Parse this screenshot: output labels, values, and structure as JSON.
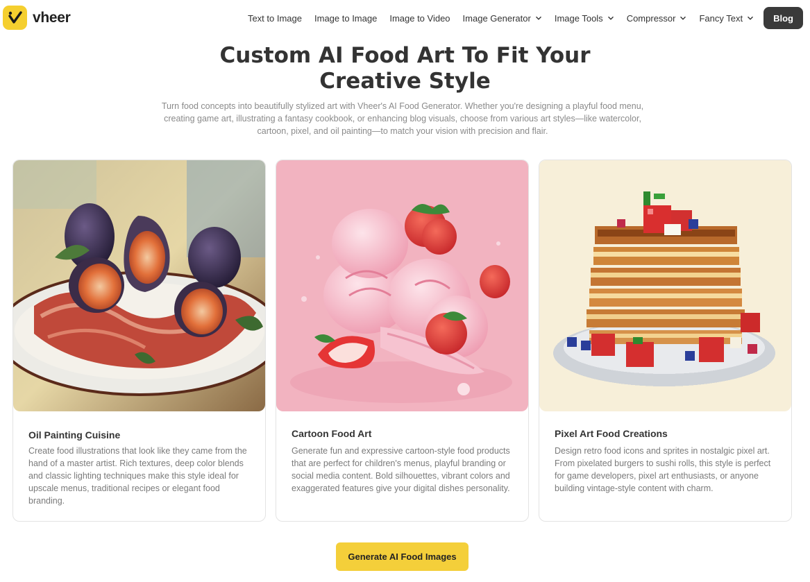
{
  "brand": {
    "name": "vheer",
    "accent": "#f5cf2f"
  },
  "nav": {
    "items": [
      {
        "label": "Text to Image",
        "dropdown": false
      },
      {
        "label": "Image to Image",
        "dropdown": false
      },
      {
        "label": "Image to Video",
        "dropdown": false
      },
      {
        "label": "Image Generator",
        "dropdown": true
      },
      {
        "label": "Image Tools",
        "dropdown": true
      },
      {
        "label": "Compressor",
        "dropdown": true
      },
      {
        "label": "Fancy Text",
        "dropdown": true
      }
    ],
    "blog_label": "Blog"
  },
  "hero": {
    "title_line1": "Custom AI Food Art To Fit Your",
    "title_line2": "Creative Style",
    "subtitle": "Turn food concepts into beautifully stylized art with Vheer's AI Food Generator. Whether you're designing a playful food menu, creating game art, illustrating a fantasy cookbook, or enhancing blog visuals, choose from various art styles—like watercolor, cartoon, pixel, and oil painting—to match your vision with precision and flair."
  },
  "cards": [
    {
      "title": "Oil Painting Cuisine",
      "description": "Create food illustrations that look like they came from the hand of a master artist. Rich textures, deep color blends and classic lighting techniques make this style ideal for upscale menus, traditional recipes or elegant food branding."
    },
    {
      "title": "Cartoon Food Art",
      "description": "Generate fun and expressive cartoon-style food products that are perfect for children's menus, playful branding or social media content. Bold silhouettes, vibrant colors and exaggerated features give your digital dishes personality."
    },
    {
      "title": "Pixel Art Food Creations",
      "description": "Design retro food icons and sprites in nostalgic pixel art. From pixelated burgers to sushi rolls, this style is perfect for game developers, pixel art enthusiasts, or anyone building vintage-style content with charm."
    }
  ],
  "cta": {
    "label": "Generate AI Food Images",
    "color": "#f4cf3a"
  }
}
